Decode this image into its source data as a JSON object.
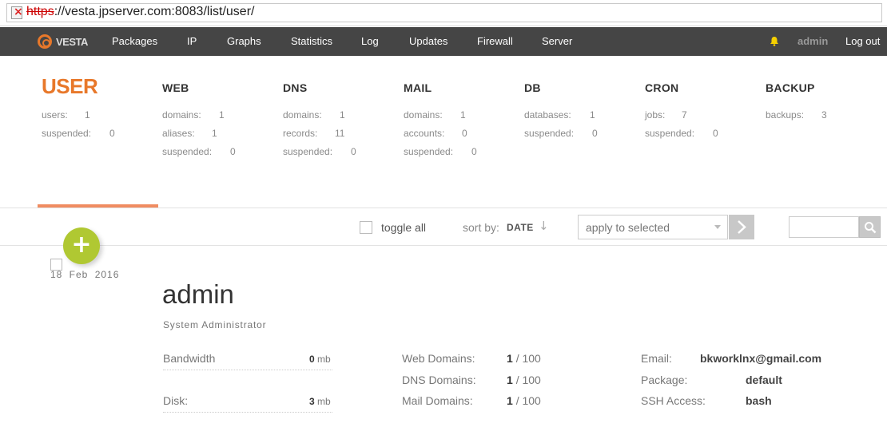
{
  "browser": {
    "url_scheme": "https",
    "url_rest": "://vesta.jpserver.com:8083/list/user/"
  },
  "nav": {
    "logo_text": "VESTA",
    "items": [
      "Packages",
      "IP",
      "Graphs",
      "Statistics",
      "Log",
      "Updates",
      "Firewall",
      "Server"
    ],
    "user": "admin",
    "logout": "Log out"
  },
  "stats": {
    "user": {
      "title": "USER",
      "rows": [
        {
          "label": "users:",
          "value": "1"
        },
        {
          "label": "suspended:",
          "value": "0"
        }
      ]
    },
    "web": {
      "title": "WEB",
      "rows": [
        {
          "label": "domains:",
          "value": "1"
        },
        {
          "label": "aliases:",
          "value": "1"
        },
        {
          "label": "suspended:",
          "value": "0"
        }
      ]
    },
    "dns": {
      "title": "DNS",
      "rows": [
        {
          "label": "domains:",
          "value": "1"
        },
        {
          "label": "records:",
          "value": "11"
        },
        {
          "label": "suspended:",
          "value": "0"
        }
      ]
    },
    "mail": {
      "title": "MAIL",
      "rows": [
        {
          "label": "domains:",
          "value": "1"
        },
        {
          "label": "accounts:",
          "value": "0"
        },
        {
          "label": "suspended:",
          "value": "0"
        }
      ]
    },
    "db": {
      "title": "DB",
      "rows": [
        {
          "label": "databases:",
          "value": "1"
        },
        {
          "label": "suspended:",
          "value": "0"
        }
      ]
    },
    "cron": {
      "title": "CRON",
      "rows": [
        {
          "label": "jobs:",
          "value": "7"
        },
        {
          "label": "suspended:",
          "value": "0"
        }
      ]
    },
    "backup": {
      "title": "BACKUP",
      "rows": [
        {
          "label": "backups:",
          "value": "3"
        }
      ]
    }
  },
  "toolbar": {
    "toggle_all": "toggle all",
    "sort_by": "sort by:",
    "sort_value": "DATE",
    "sort_arrow": "↓",
    "apply_placeholder": "apply to selected",
    "search_value": ""
  },
  "add_button": "+",
  "user": {
    "date": "18 Feb 2016",
    "name": "admin",
    "role": "System Administrator",
    "bandwidth_label": "Bandwidth",
    "bandwidth_value": "0",
    "bandwidth_unit": "mb",
    "disk_label": "Disk:",
    "disk_value": "3",
    "disk_unit": "mb",
    "web_domains_label": "Web Domains:",
    "web_domains_used": "1",
    "web_domains_limit": "/ 100",
    "dns_domains_label": "DNS Domains:",
    "dns_domains_used": "1",
    "dns_domains_limit": "/ 100",
    "mail_domains_label": "Mail Domains:",
    "mail_domains_used": "1",
    "mail_domains_limit": "/ 100",
    "email_label": "Email:",
    "email_value": "bkworklnx@gmail.com",
    "package_label": "Package:",
    "package_value": "default",
    "ssh_label": "SSH Access:",
    "ssh_value": "bash"
  },
  "colors": {
    "accent": "#e8782a",
    "nav_bg": "#454545",
    "add_button": "#b0c832"
  }
}
